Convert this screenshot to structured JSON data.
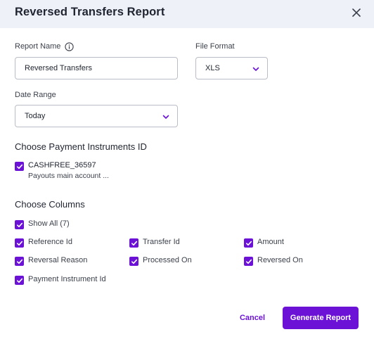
{
  "dialog": {
    "title": "Reversed Transfers Report",
    "close_icon": "close-icon"
  },
  "form": {
    "report_name": {
      "label": "Report Name",
      "value": "Reversed Transfers",
      "info_icon": "info-icon"
    },
    "file_format": {
      "label": "File Format",
      "value": "XLS"
    },
    "date_range": {
      "label": "Date Range",
      "value": "Today"
    }
  },
  "payment_instruments": {
    "title": "Choose Payment Instruments ID",
    "items": [
      {
        "id": "CASHFREE_36597",
        "description": "Payouts main account ...",
        "checked": true
      }
    ]
  },
  "columns": {
    "title": "Choose Columns",
    "show_all": {
      "label": "Show All (7)",
      "checked": true
    },
    "items": [
      {
        "label": "Reference Id",
        "checked": true
      },
      {
        "label": "Transfer Id",
        "checked": true
      },
      {
        "label": "Amount",
        "checked": true
      },
      {
        "label": "Reversal Reason",
        "checked": true
      },
      {
        "label": "Processed On",
        "checked": true
      },
      {
        "label": "Reversed On",
        "checked": true
      },
      {
        "label": "Payment Instrument Id",
        "checked": true
      }
    ]
  },
  "footer": {
    "cancel_label": "Cancel",
    "generate_label": "Generate Report"
  },
  "colors": {
    "accent": "#6b12d6",
    "header_bg": "#eef1f8"
  }
}
